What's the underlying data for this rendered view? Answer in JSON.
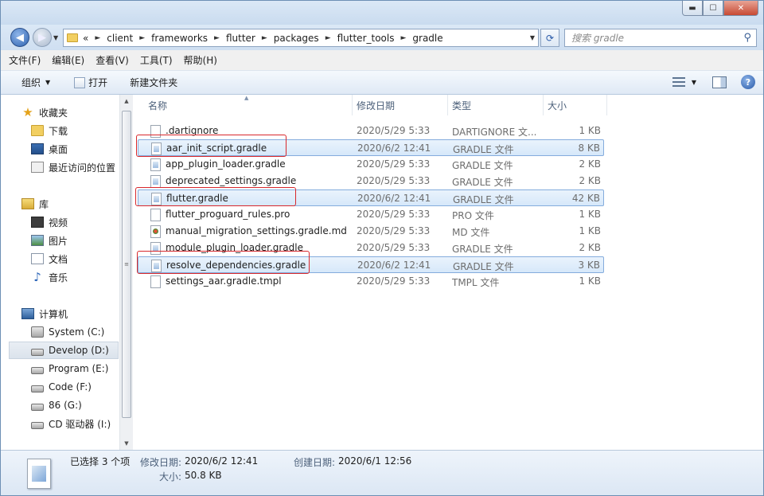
{
  "window": {
    "controls": {
      "minimize": "▬",
      "maximize": "☐",
      "close": "✕"
    }
  },
  "address": {
    "overflow": "«",
    "crumbs": [
      "client",
      "frameworks",
      "flutter",
      "packages",
      "flutter_tools",
      "gradle"
    ],
    "search_placeholder": "搜索 gradle"
  },
  "menu": [
    "文件(F)",
    "编辑(E)",
    "查看(V)",
    "工具(T)",
    "帮助(H)"
  ],
  "commands": {
    "organize": "组织",
    "open": "打开",
    "new_folder": "新建文件夹"
  },
  "nav": {
    "favorites": "收藏夹",
    "downloads": "下载",
    "desktop": "桌面",
    "recent": "最近访问的位置",
    "libraries": "库",
    "videos": "视频",
    "pictures": "图片",
    "documents": "文档",
    "music": "音乐",
    "computer": "计算机",
    "drives": [
      "System (C:)",
      "Develop (D:)",
      "Program (E:)",
      "Code (F:)",
      "86 (G:)",
      "CD 驱动器 (I:)"
    ]
  },
  "columns": {
    "name": "名称",
    "date": "修改日期",
    "type": "类型",
    "size": "大小"
  },
  "files": [
    {
      "name": ".dartignore",
      "date": "2020/5/29 5:33",
      "type": "DARTIGNORE 文...",
      "size": "1 KB",
      "icon": "blank-file-icon",
      "selected": false
    },
    {
      "name": "aar_init_script.gradle",
      "date": "2020/6/2 12:41",
      "type": "GRADLE 文件",
      "size": "8 KB",
      "icon": "gradle-file-icon",
      "selected": true
    },
    {
      "name": "app_plugin_loader.gradle",
      "date": "2020/5/29 5:33",
      "type": "GRADLE 文件",
      "size": "2 KB",
      "icon": "gradle-file-icon",
      "selected": false
    },
    {
      "name": "deprecated_settings.gradle",
      "date": "2020/5/29 5:33",
      "type": "GRADLE 文件",
      "size": "2 KB",
      "icon": "gradle-file-icon",
      "selected": false
    },
    {
      "name": "flutter.gradle",
      "date": "2020/6/2 12:41",
      "type": "GRADLE 文件",
      "size": "42 KB",
      "icon": "gradle-file-icon",
      "selected": true
    },
    {
      "name": "flutter_proguard_rules.pro",
      "date": "2020/5/29 5:33",
      "type": "PRO 文件",
      "size": "1 KB",
      "icon": "blank-file-icon",
      "selected": false
    },
    {
      "name": "manual_migration_settings.gradle.md",
      "date": "2020/5/29 5:33",
      "type": "MD 文件",
      "size": "1 KB",
      "icon": "md-file-icon",
      "selected": false
    },
    {
      "name": "module_plugin_loader.gradle",
      "date": "2020/5/29 5:33",
      "type": "GRADLE 文件",
      "size": "2 KB",
      "icon": "gradle-file-icon",
      "selected": false
    },
    {
      "name": "resolve_dependencies.gradle",
      "date": "2020/6/2 12:41",
      "type": "GRADLE 文件",
      "size": "3 KB",
      "icon": "gradle-file-icon",
      "selected": true
    },
    {
      "name": "settings_aar.gradle.tmpl",
      "date": "2020/5/29 5:33",
      "type": "TMPL 文件",
      "size": "1 KB",
      "icon": "blank-file-icon",
      "selected": false
    }
  ],
  "details": {
    "selected": "已选择 3 个项",
    "modified_label": "修改日期:",
    "modified_value": "2020/6/2 12:41",
    "created_label": "创建日期:",
    "created_value": "2020/6/1 12:56",
    "size_label": "大小:",
    "size_value": "50.8 KB"
  },
  "colors": {
    "highlight": "#d8282c",
    "selection": "#d6e8fa"
  }
}
